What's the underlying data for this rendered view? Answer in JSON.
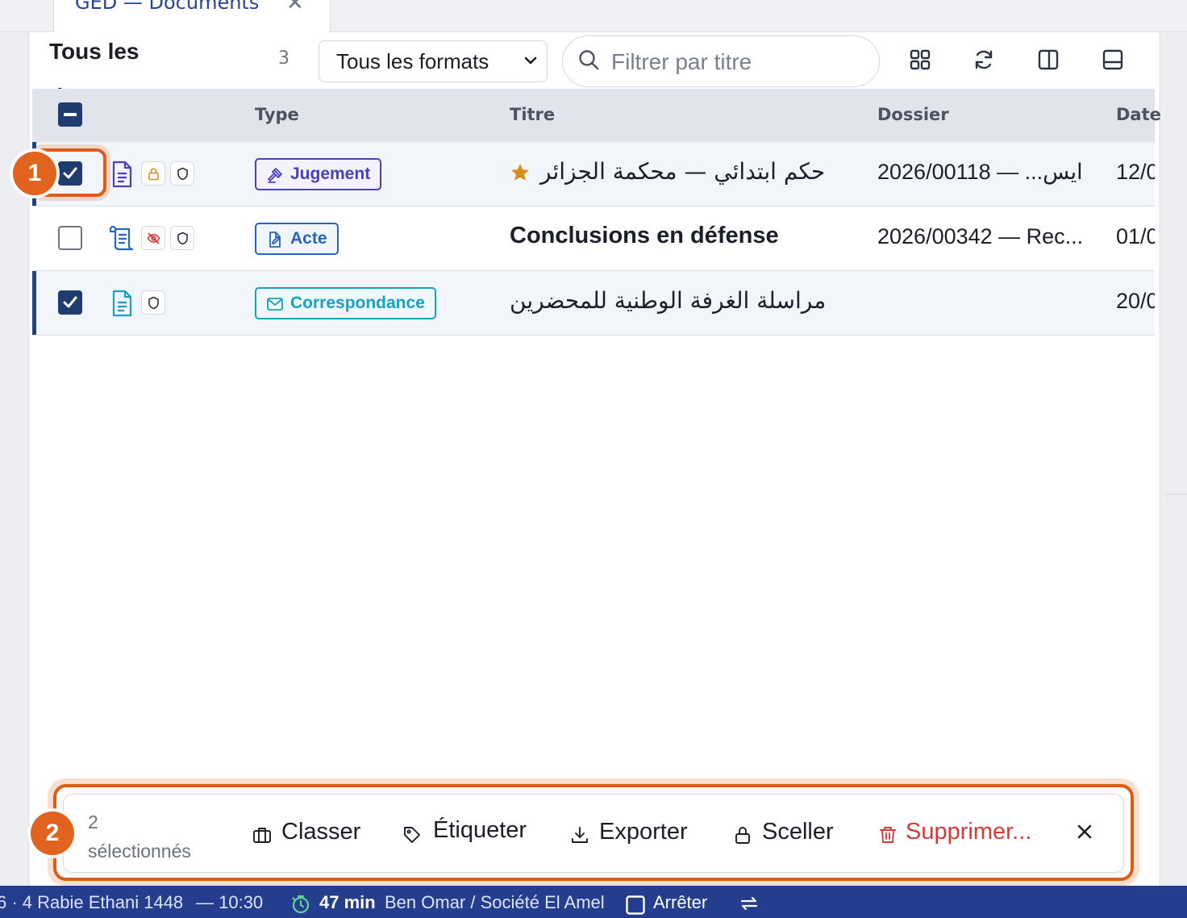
{
  "tab": {
    "title": "GED — Documents",
    "close_label": "✕"
  },
  "toolbar": {
    "title": "Tous les documents",
    "count": "3",
    "format_select": "Tous les formats",
    "search_placeholder": "Filtrer par titre",
    "buttons": [
      "grid-view-icon",
      "refresh-icon",
      "side-panel-icon",
      "bottom-panel-icon"
    ]
  },
  "table": {
    "columns": {
      "type": "Type",
      "title": "Titre",
      "folder": "Dossier",
      "date": "Date"
    },
    "rows": [
      {
        "selected": true,
        "starred": true,
        "type": "Jugement",
        "title": "حكم ابتدائي — محكمة الجزائر",
        "folder": "2026/00118 — ...ايس",
        "date": "12/0"
      },
      {
        "selected": false,
        "starred": false,
        "type": "Acte",
        "title": "Conclusions en défense",
        "folder": "2026/00342 — Rec...",
        "date": "01/0"
      },
      {
        "selected": true,
        "starred": false,
        "type": "Correspondance",
        "title": "مراسلة الغرفة الوطنية للمحضرين",
        "folder": "",
        "date": "20/0"
      }
    ]
  },
  "callouts": {
    "one": "1",
    "two": "2"
  },
  "bulk_bar": {
    "count_num": "2",
    "count_label": "sélectionnés",
    "actions": {
      "classer": "Classer",
      "etiqueter": "Étiqueter",
      "exporter": "Exporter",
      "sceller": "Sceller",
      "supprimer": "Supprimer..."
    }
  },
  "status_bar": {
    "date_fragment": "6 · 4 Rabie Ethani 1448",
    "time": "— 10:30",
    "timer": "47 min",
    "client": "Ben Omar / Société El Amel",
    "stop_label": "Arrêter"
  },
  "colors": {
    "accent": "#1f3c6e",
    "status_bar": "#243d8c",
    "callout": "#e0641e",
    "jugement": "#4a3fc2",
    "acte": "#2466c4",
    "correspondance": "#1aa0c6",
    "danger": "#d43b3b",
    "star": "#d4901c"
  }
}
